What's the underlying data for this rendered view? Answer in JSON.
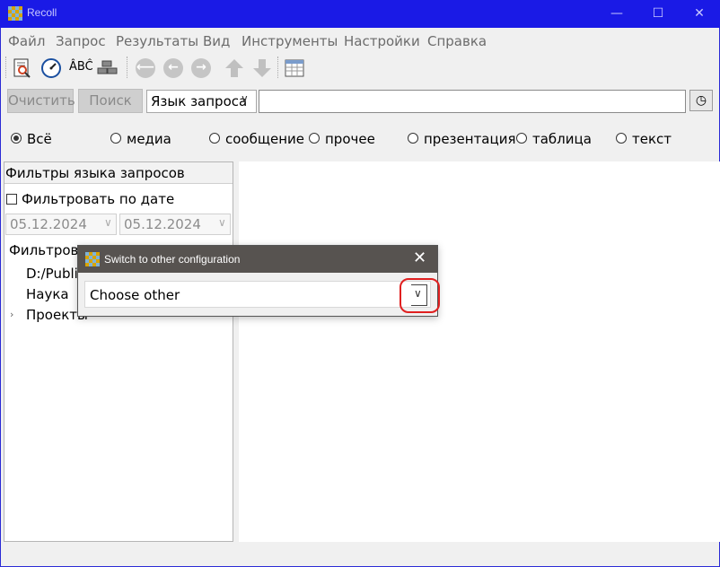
{
  "app": {
    "title": "Recoll"
  },
  "window_controls": {
    "minimize": "—",
    "maximize": "☐",
    "close": "✕"
  },
  "menu": [
    "Файл",
    "Запрос",
    "Результаты",
    "Вид",
    "Инструменты",
    "Настройки",
    "Справка"
  ],
  "toolbar": {
    "spell_label": "ÂBĈ"
  },
  "search": {
    "clear_label": "Очистить",
    "search_label": "Поиск",
    "mode_label": "Язык запроса",
    "query_value": "",
    "history_icon": "◷"
  },
  "categories": [
    {
      "label": "Всё",
      "selected": true
    },
    {
      "label": "медиа",
      "selected": false
    },
    {
      "label": "сообщение",
      "selected": false
    },
    {
      "label": "прочее",
      "selected": false
    },
    {
      "label": "презентация",
      "selected": false
    },
    {
      "label": "таблица",
      "selected": false
    },
    {
      "label": "текст",
      "selected": false
    }
  ],
  "filters": {
    "title": "Фильтры языка запросов",
    "date_filter_label": "Фильтровать по дате",
    "date_from": "05.12.2024",
    "date_to": "05.12.2024",
    "dir_filter_label": "Фильтрова",
    "tree": [
      "D:/Public",
      "Наука",
      "Проекты"
    ]
  },
  "dialog": {
    "title": "Switch to other configuration",
    "combo_value": "Choose other",
    "close": "✕"
  }
}
